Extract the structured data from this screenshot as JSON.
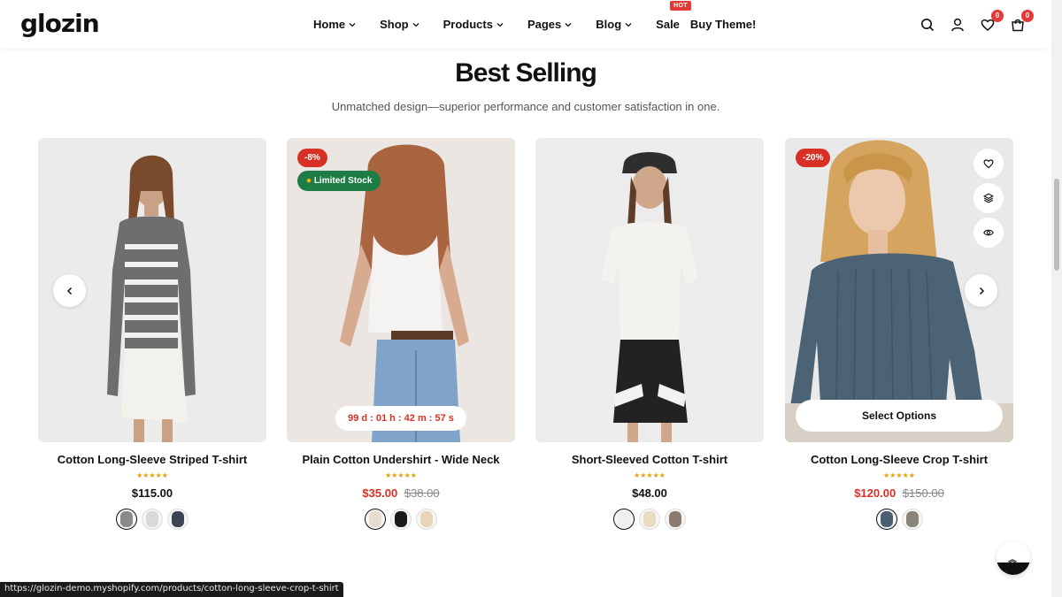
{
  "header": {
    "logo": "glozin",
    "nav": [
      {
        "label": "Home"
      },
      {
        "label": "Shop"
      },
      {
        "label": "Products"
      },
      {
        "label": "Pages"
      },
      {
        "label": "Blog"
      },
      {
        "label": "Sale",
        "badge": "HOT"
      },
      {
        "label": "Buy Theme!"
      }
    ],
    "wishlist_count": "0",
    "cart_count": "0"
  },
  "section": {
    "title": "Best Selling",
    "subtitle": "Unmatched design—superior performance and customer satisfaction in one."
  },
  "products": [
    {
      "name": "Cotton Long-Sleeve Striped T-shirt",
      "stars": "★★★★★",
      "price": "$115.00",
      "swatches": [
        "#8a8a8a",
        "#d9d9d9",
        "#3b4450"
      ]
    },
    {
      "name": "Plain Cotton Undershirt - Wide Neck",
      "discount": "-8%",
      "stock_badge": "Limited Stock",
      "countdown": "99 d : 01 h : 42 m : 57 s",
      "stars": "★★★★★",
      "price": "$35.00",
      "price_old": "$38.00",
      "swatches": [
        "#e8dcd0",
        "#1a1a1a",
        "#e9d6b8"
      ]
    },
    {
      "name": "Short-Sleeved Cotton T-shirt",
      "stars": "★★★★★",
      "price": "$48.00",
      "swatches": [
        "#efefef",
        "#eadbbf",
        "#8b7a70"
      ]
    },
    {
      "name": "Cotton Long-Sleeve Crop T-shirt",
      "discount": "-20%",
      "select_label": "Select Options",
      "stars": "★★★★★",
      "price": "$120.00",
      "price_old": "$150.00",
      "swatches": [
        "#4a5f72",
        "#8a8478"
      ]
    }
  ],
  "status_url": "https://glozin-demo.myshopify.com/products/cotton-long-sleeve-crop-t-shirt",
  "colors": {
    "accent_red": "#d93025",
    "stock_green": "#1e7d44",
    "star_gold": "#e6a100"
  },
  "icons": [
    "search-icon",
    "user-icon",
    "heart-icon",
    "cart-icon",
    "chevron-left-icon",
    "chevron-right-icon",
    "layers-icon",
    "eye-icon",
    "arrow-up-icon"
  ]
}
